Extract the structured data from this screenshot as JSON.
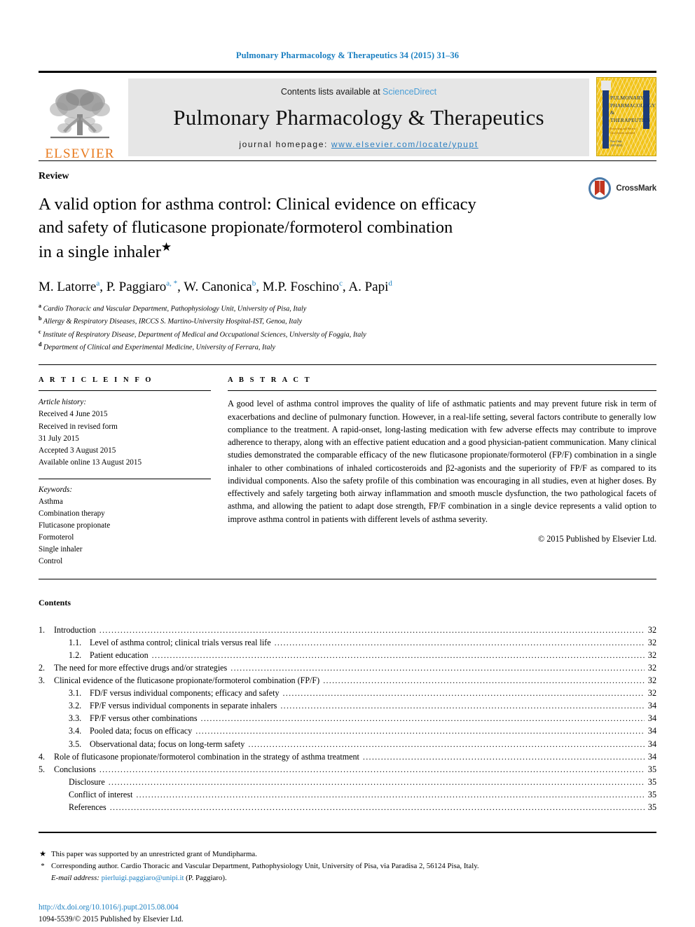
{
  "running_head": "Pulmonary Pharmacology & Therapeutics 34 (2015) 31–36",
  "masthead": {
    "publisher_name": "ELSEVIER",
    "contents_prefix": "Contents lists available at ",
    "contents_link": "ScienceDirect",
    "journal_title": "Pulmonary Pharmacology & Therapeutics",
    "homepage_prefix": "journal homepage: ",
    "homepage_url": "www.elsevier.com/locate/ypupt",
    "cover": {
      "title_line1": "PULMONARY",
      "title_line2": "PHARMACOLOGY",
      "title_line3": "& THERAPEUTICS",
      "sub_line1": "Recording and Review",
      "sub_line2": "Case reports accepted",
      "sub_line3": "Now Only",
      "sub_line4": "1097-8583"
    }
  },
  "article": {
    "type_label": "Review",
    "title_line1": "A valid option for asthma control: Clinical evidence on efficacy",
    "title_line2": "and safety of fluticasone propionate/formoterol combination",
    "title_line3": "in a single inhaler",
    "title_star": "★",
    "crossmark_label": "CrossMark",
    "authors": [
      {
        "name": "M. Latorre",
        "sup": "a",
        "sep": ", "
      },
      {
        "name": "P. Paggiaro",
        "sup": "a, *",
        "sep": ", "
      },
      {
        "name": "W. Canonica",
        "sup": "b",
        "sep": ", "
      },
      {
        "name": "M.P. Foschino",
        "sup": "c",
        "sep": ", "
      },
      {
        "name": "A. Papi",
        "sup": "d",
        "sep": ""
      }
    ],
    "affiliations": [
      {
        "mark": "a",
        "text": "Cardio Thoracic and Vascular Department, Pathophysiology Unit, University of Pisa, Italy"
      },
      {
        "mark": "b",
        "text": "Allergy & Respiratory Diseases, IRCCS S. Martino-University Hospital-IST, Genoa, Italy"
      },
      {
        "mark": "c",
        "text": "Institute of Respiratory Disease, Department of Medical and Occupational Sciences, University of Foggia, Italy"
      },
      {
        "mark": "d",
        "text": "Department of Clinical and Experimental Medicine, University of Ferrara, Italy"
      }
    ]
  },
  "article_info": {
    "heading": "A R T I C L E  I N F O",
    "history_label": "Article history:",
    "history": [
      "Received 4 June 2015",
      "Received in revised form",
      "31 July 2015",
      "Accepted 3 August 2015",
      "Available online 13 August 2015"
    ],
    "keywords_label": "Keywords:",
    "keywords": [
      "Asthma",
      "Combination therapy",
      "Fluticasone propionate",
      "Formoterol",
      "Single inhaler",
      "Control"
    ]
  },
  "abstract": {
    "heading": "A B S T R A C T",
    "body": "A good level of asthma control improves the quality of life of asthmatic patients and may prevent future risk in term of exacerbations and decline of pulmonary function. However, in a real-life setting, several factors contribute to generally low compliance to the treatment. A rapid-onset, long-lasting medication with few adverse effects may contribute to improve adherence to therapy, along with an effective patient education and a good physician-patient communication. Many clinical studies demonstrated the comparable efficacy of the new fluticasone propionate/formoterol (FP/F) combination in a single inhaler to other combinations of inhaled corticosteroids and β2-agonists and the superiority of FP/F as compared to its individual components. Also the safety profile of this combination was encouraging in all studies, even at higher doses. By effectively and safely targeting both airway inflammation and smooth muscle dysfunction, the two pathological facets of asthma, and allowing the patient to adapt dose strength, FP/F combination in a single device represents a valid option to improve asthma control in patients with different levels of asthma severity.",
    "copyright": "© 2015 Published by Elsevier Ltd."
  },
  "contents": {
    "heading": "Contents",
    "entries": [
      {
        "level": 1,
        "num": "1.",
        "label": "Introduction",
        "page": "32"
      },
      {
        "level": 2,
        "num": "1.1.",
        "label": "Level of asthma control; clinical trials versus real life",
        "page": "32"
      },
      {
        "level": 2,
        "num": "1.2.",
        "label": "Patient education",
        "page": "32"
      },
      {
        "level": 1,
        "num": "2.",
        "label": "The need for more effective drugs and/or strategies",
        "page": "32"
      },
      {
        "level": 1,
        "num": "3.",
        "label": "Clinical evidence of the fluticasone propionate/formoterol combination (FP/F)",
        "page": "32"
      },
      {
        "level": 2,
        "num": "3.1.",
        "label": "FD/F versus individual components; efficacy and safety",
        "page": "32"
      },
      {
        "level": 2,
        "num": "3.2.",
        "label": "FP/F versus individual components in separate inhalers",
        "page": "34"
      },
      {
        "level": 2,
        "num": "3.3.",
        "label": "FP/F versus other combinations",
        "page": "34"
      },
      {
        "level": 2,
        "num": "3.4.",
        "label": "Pooled data; focus on efficacy",
        "page": "34"
      },
      {
        "level": 2,
        "num": "3.5.",
        "label": "Observational data; focus on long-term safety",
        "page": "34"
      },
      {
        "level": 1,
        "num": "4.",
        "label": "Role of fluticasone propionate/formoterol combination in the strategy of asthma treatment",
        "page": "34"
      },
      {
        "level": 1,
        "num": "5.",
        "label": "Conclusions",
        "page": "35"
      },
      {
        "level": 3,
        "num": "",
        "label": "Disclosure",
        "page": "35"
      },
      {
        "level": 3,
        "num": "",
        "label": "Conflict of interest",
        "page": "35"
      },
      {
        "level": 3,
        "num": "",
        "label": "References",
        "page": "35"
      }
    ]
  },
  "footnotes": {
    "star_mark": "★",
    "star_text": "This paper was supported by an unrestricted grant of Mundipharma.",
    "corr_mark": "*",
    "corr_text": "Corresponding author. Cardio Thoracic and Vascular Department, Pathophysiology Unit, University of Pisa, via Paradisa 2, 56124 Pisa, Italy.",
    "email_label": "E-mail address:",
    "email": "pierluigi.paggiaro@unipi.it",
    "email_owner": "(P. Paggiaro)."
  },
  "footer": {
    "doi": "http://dx.doi.org/10.1016/j.pupt.2015.08.004",
    "issn_line": "1094-5539/© 2015 Published by Elsevier Ltd."
  }
}
